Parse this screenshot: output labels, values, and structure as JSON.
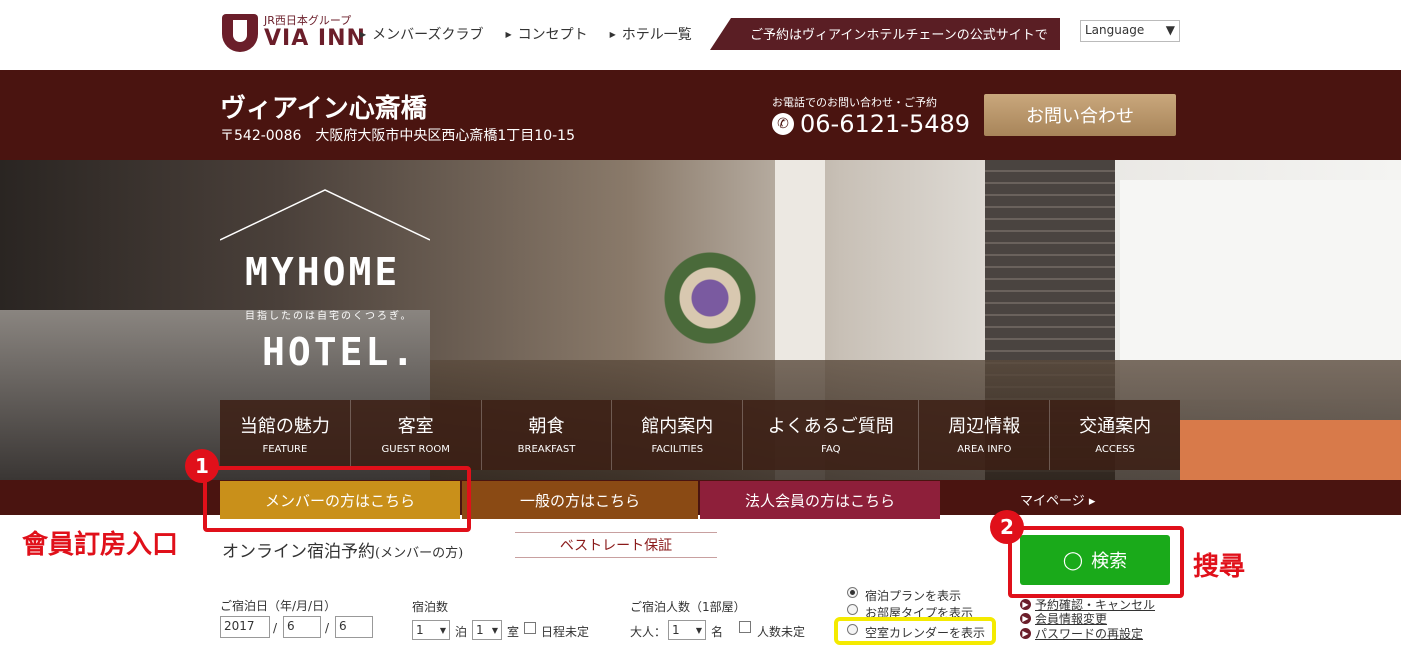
{
  "header": {
    "logo_small": "JR西日本グループ",
    "logo_big": "VIA INN",
    "nav": [
      "メンバーズクラブ",
      "コンセプト",
      "ホテル一覧"
    ],
    "banner": "ご予約はヴィアインホテルチェーンの公式サイトで",
    "language": "Language"
  },
  "hotel": {
    "name": "ヴィアイン心斎橋",
    "address": "〒542-0086　大阪府大阪市中央区西心斎橋1丁目10-15",
    "phone_label": "お電話でのお問い合わせ・ご予約",
    "phone": "06-6121-5489",
    "contact_button": "お問い合わせ"
  },
  "hero": {
    "line1": "MYHOME",
    "subline": "目指したのは自宅のくつろぎ。",
    "line2": "HOTEL."
  },
  "menu": [
    {
      "jp": "当館の魅力",
      "en": "FEATURE"
    },
    {
      "jp": "客室",
      "en": "GUEST ROOM"
    },
    {
      "jp": "朝食",
      "en": "BREAKFAST"
    },
    {
      "jp": "館内案内",
      "en": "FACILITIES"
    },
    {
      "jp": "よくあるご質問",
      "en": "FAQ"
    },
    {
      "jp": "周辺情報",
      "en": "AREA INFO"
    },
    {
      "jp": "交通案内",
      "en": "ACCESS"
    }
  ],
  "tabs": {
    "member": "メンバーの方はこちら",
    "general": "一般の方はこちら",
    "corporate": "法人会員の方はこちら",
    "mypage": "マイページ ▸"
  },
  "annotations": {
    "badge1": "1",
    "badge2": "2",
    "label1": "會員訂房入口",
    "label2": "搜尋"
  },
  "booking": {
    "title": "オンライン宿泊予約",
    "title_suffix": "(メンバーの方)",
    "best_rate": "ベストレート保証",
    "date_label": "ご宿泊日（年/月/日）",
    "year": "2017",
    "month": "6",
    "day": "6",
    "slash": "/",
    "nights_label": "宿泊数",
    "nights": "1",
    "nights_unit": "泊",
    "rooms": "1",
    "rooms_unit": "室",
    "undecided_date": "日程未定",
    "guests_label": "ご宿泊人数（1部屋）",
    "adults_label": "大人：",
    "adults": "1",
    "adults_unit": "名",
    "undecided_guests": "人数未定",
    "radio_plan": "宿泊プランを表示",
    "radio_roomtype": "お部屋タイプを表示",
    "radio_calendar": "空室カレンダーを表示",
    "search_button": "検索",
    "links": [
      "予約確認・キャンセル",
      "会員情報変更",
      "パスワードの再設定"
    ]
  },
  "colors": {
    "brand": "#4a1410",
    "member_tab": "#c9901a",
    "general_tab": "#8a4a14",
    "corporate_tab": "#8e1f3a",
    "search": "#1aaa1a",
    "annotation_red": "#e0101a",
    "annotation_yellow": "#f4ea00"
  }
}
